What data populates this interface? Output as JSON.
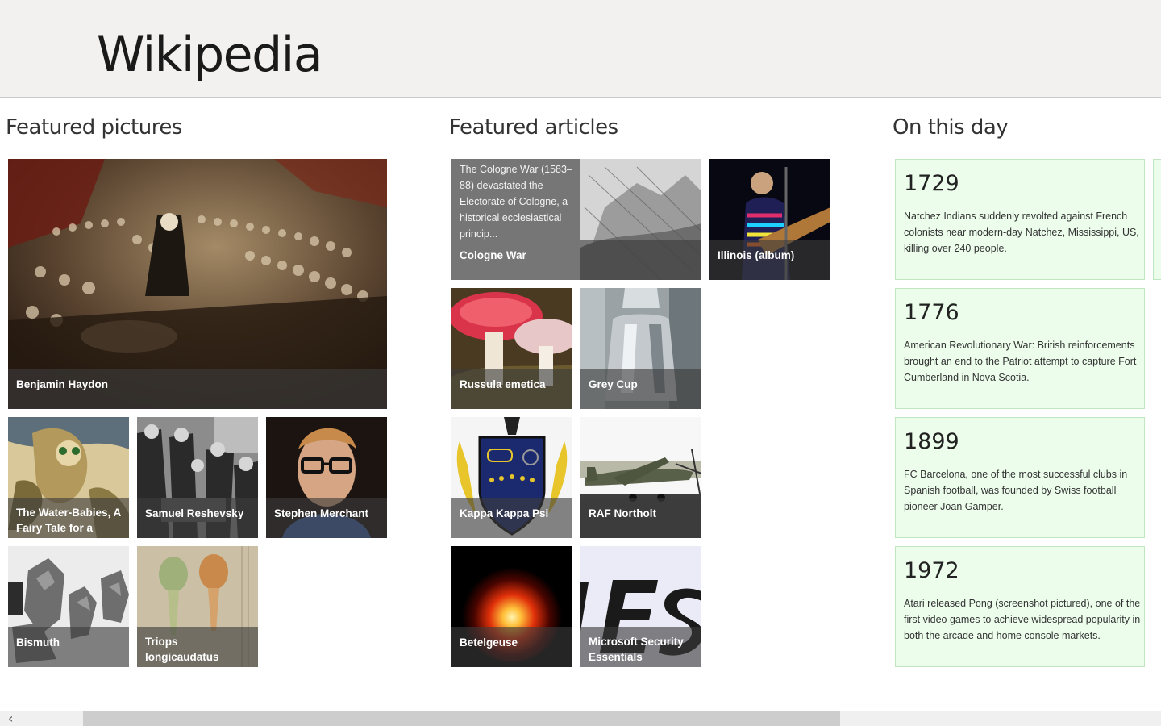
{
  "app": {
    "title": "Wikipedia"
  },
  "sections": {
    "featured_pictures": "Featured pictures",
    "featured_articles": "Featured articles",
    "on_this_day": "On this day"
  },
  "featured_pictures": [
    {
      "caption": "Benjamin Haydon"
    },
    {
      "caption": "The Water-Babies, A Fairy Tale for a"
    },
    {
      "caption": "Samuel Reshevsky"
    },
    {
      "caption": "Stephen Merchant"
    },
    {
      "caption": "Bismuth"
    },
    {
      "caption": "Triops longicaudatus"
    }
  ],
  "featured_articles": [
    {
      "caption": "Cologne War",
      "summary": "The Cologne War (1583–88) devastated the Electorate of Cologne, a historical ecclesiastical princip..."
    },
    {
      "caption": "Illinois (album)"
    },
    {
      "caption": "Russula emetica"
    },
    {
      "caption": "Grey Cup"
    },
    {
      "caption": "Kappa Kappa Psi"
    },
    {
      "caption": "RAF Northolt"
    },
    {
      "caption": "Betelgeuse"
    },
    {
      "caption": "Microsoft Security Essentials"
    }
  ],
  "on_this_day": [
    {
      "year": "1729",
      "text": "Natchez Indians suddenly revolted against French colonists near modern-day Natchez, Mississippi, US, killing over 240 people."
    },
    {
      "year": "1776",
      "text": "American Revolutionary War: British reinforcements brought an end to the Patriot attempt to capture Fort Cumberland in Nova Scotia."
    },
    {
      "year": "1899",
      "text": "FC Barcelona, one of the most successful clubs in Spanish football, was founded by Swiss football pioneer Joan Gamper."
    },
    {
      "year": "1972",
      "text": "Atari released Pong (screenshot pictured), one of the first video games to achieve widespread popularity in both the arcade and home console markets."
    }
  ],
  "scrollbar": {
    "left_arrow": "‹"
  }
}
